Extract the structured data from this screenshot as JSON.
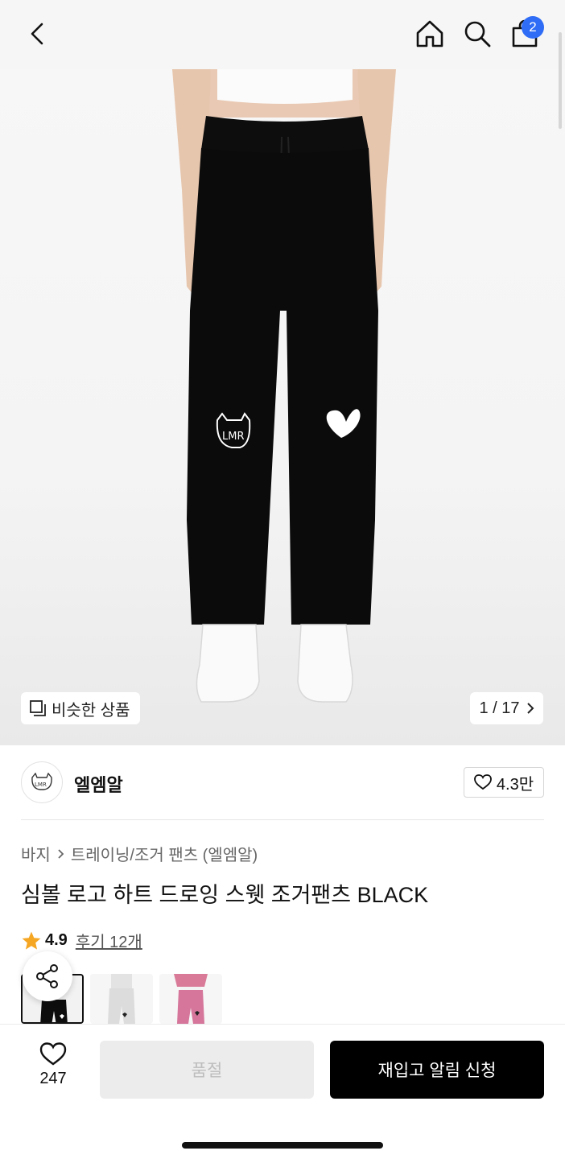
{
  "header": {
    "back_icon": "chevron-left-icon",
    "home_icon": "home-icon",
    "search_icon": "search-icon",
    "cart_icon": "shopping-bag-icon",
    "cart_count": "2",
    "badge_color": "#2f6df6"
  },
  "gallery": {
    "similar_label": "비슷한 상품",
    "pager_text": "1 / 17"
  },
  "brand": {
    "logo_text": "LMR",
    "name": "엘엠알",
    "likes": "4.3만"
  },
  "breadcrumb": {
    "category": "바지",
    "subcategory": "트레이닝/조거 팬츠 (엘엠알)"
  },
  "product": {
    "title": "심볼 로고 하트 드로잉 스웻 조거팬츠 BLACK",
    "rating": "4.9",
    "review_label": "후기 12개",
    "star_color": "#f5a623"
  },
  "thumbnails": [
    "black",
    "grey",
    "pink"
  ],
  "bottom_bar": {
    "wish_count": "247",
    "soldout_label": "품절",
    "restock_label": "재입고 알림 신청"
  }
}
